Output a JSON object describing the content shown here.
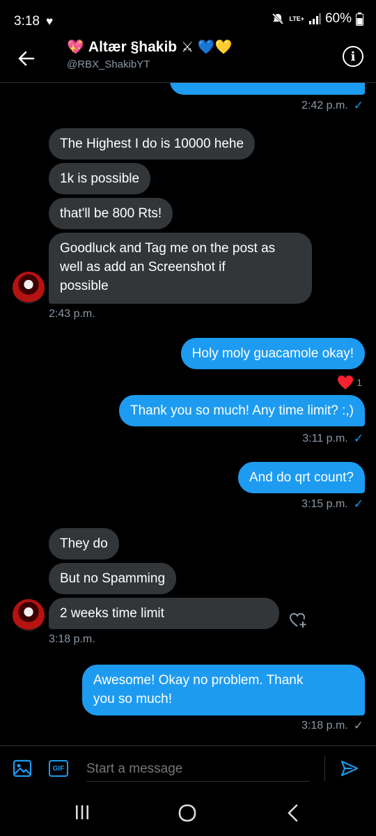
{
  "status": {
    "time": "3:18",
    "heart": "♥",
    "network": "LTE+",
    "battery": "60%"
  },
  "header": {
    "display_name": "Altær §hakib",
    "handle": "@RBX_ShakibYT",
    "emoji_before": "💖",
    "emoji_after": "⚔ 💙💛"
  },
  "messages": {
    "m0_ts": "2:42 p.m.",
    "m1": "The Highest I do is 10000 hehe",
    "m2": "1k is possible",
    "m3": "that'll be 800 Rts!",
    "m4a": "Goodluck and Tag me on the post as",
    "m4b": "well as add an Screenshot if",
    "m4c": "possible",
    "m4_ts": "2:43 p.m.",
    "m5": "Holy moly guacamole okay!",
    "m5_reaction_count": "1",
    "m6": "Thank you so much! Any time limit? :,)",
    "m6_ts": "3:11 p.m.",
    "m7": "And do qrt count?",
    "m7_ts": "3:15 p.m.",
    "m8": "They do",
    "m9": "But no Spamming",
    "m10": "2 weeks time limit",
    "m10_ts": "3:18 p.m.",
    "m11a": "Awesome! Okay no problem.  Thank",
    "m11b": "you so much!",
    "m11_ts": "3:18 p.m."
  },
  "composer": {
    "placeholder": "Start a message",
    "gif_label": "GIF"
  },
  "colors": {
    "accent": "#1d9bf0",
    "incoming": "#333639",
    "background": "#000000"
  },
  "icons": [
    "back-arrow-icon",
    "info-icon",
    "image-icon",
    "gif-icon",
    "send-icon",
    "heart-reaction-icon",
    "add-reaction-icon",
    "recents-icon",
    "home-icon",
    "back-icon"
  ]
}
